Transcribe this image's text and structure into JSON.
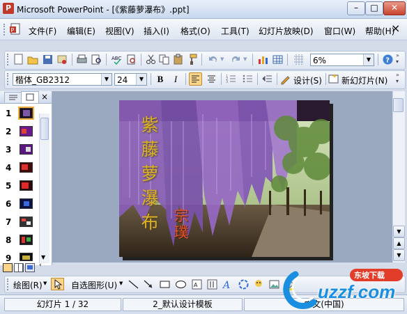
{
  "window": {
    "title": "Microsoft PowerPoint - [《紫藤萝瀑布》.ppt]",
    "app_icon": "P",
    "controls": {
      "minimize": "–",
      "maximize": "□",
      "close": "✕"
    }
  },
  "menubar": {
    "items": [
      "文件(F)",
      "编辑(E)",
      "视图(V)",
      "插入(I)",
      "格式(O)",
      "工具(T)",
      "幻灯片放映(D)",
      "窗口(W)",
      "帮助(H)"
    ],
    "close_glyph": "×"
  },
  "standard_toolbar": {
    "zoom_value": "6%"
  },
  "format_toolbar": {
    "font_name": "楷体_GB2312",
    "font_size": "24",
    "bold": "B",
    "italic": "I",
    "design_label": "设计(S)",
    "new_slide_label": "新幻灯片(N)"
  },
  "slide_pane": {
    "slide_numbers": [
      "1",
      "2",
      "3",
      "4",
      "5",
      "6",
      "7",
      "8",
      "9"
    ],
    "selected": "1"
  },
  "slide": {
    "title_chars": [
      "紫",
      "藤",
      "萝",
      "瀑",
      "布"
    ],
    "author_chars": [
      "宗",
      "璞"
    ],
    "colors": {
      "title": "#e0b024",
      "author": "#e2502a",
      "wisteria": "#8a5fb8",
      "leaves": "#5f8a3a"
    }
  },
  "drawing_toolbar": {
    "draw_label": "绘图(R)",
    "autoshape_label": "自选图形(U)"
  },
  "statusbar": {
    "slide_position": "幻灯片 1 / 32",
    "design_template": "2_默认设计模板",
    "language": "中文(中国)"
  },
  "watermark": {
    "brand": "uzzf.com",
    "tagline": "东坡下载"
  }
}
